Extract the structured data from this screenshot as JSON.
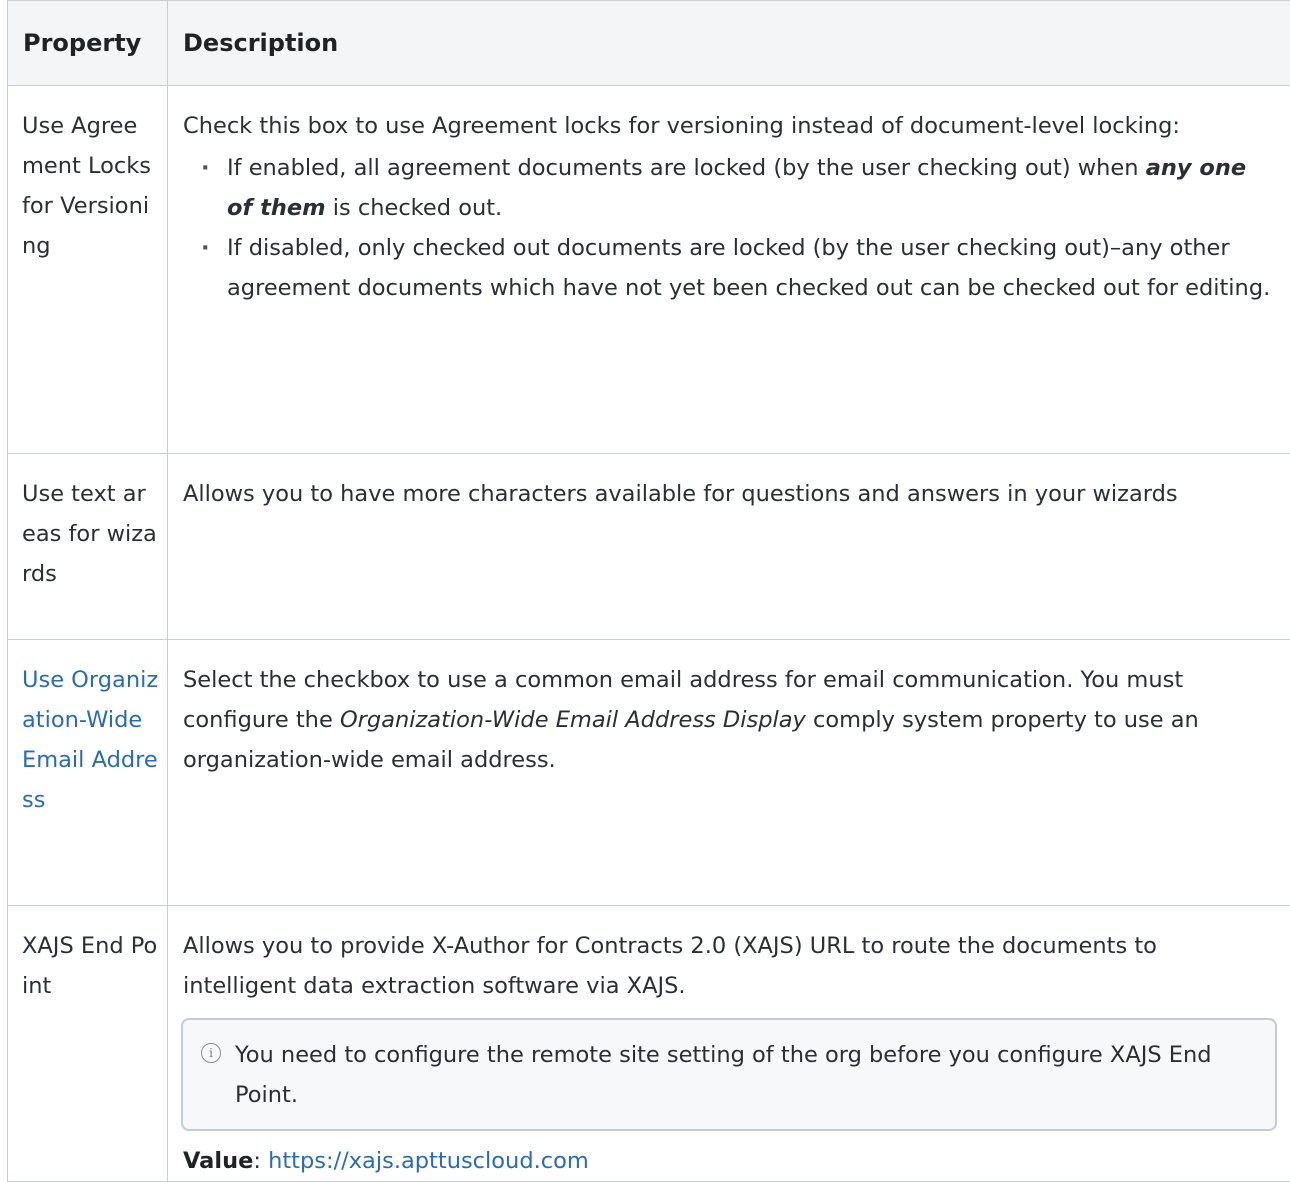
{
  "headers": {
    "property": "Property",
    "description": "Description"
  },
  "rows": [
    {
      "property": "Use Agreement Locks for Versioning",
      "intro": "Check this box to use Agreement locks for versioning instead of document-level locking:",
      "bullet1_a": "If enabled, all agreement documents are locked (by the user checking out) when ",
      "bullet1_em": "any one of them",
      "bullet1_b": " is checked out.",
      "bullet2": "If disabled, only checked out documents are locked (by the user checking out)–any other agreement documents which have not yet been checked out can be checked out for editing."
    },
    {
      "property": "Use text areas for wizards",
      "desc": "Allows you to have more characters available for questions and answers in your wizards"
    },
    {
      "property": "Use Organization-Wide Email Address",
      "desc_a": "Select the checkbox to use a common email address for email communication. You must configure the ",
      "desc_em": "Organization-Wide Email Address Display",
      "desc_b": " comply system property to use an organization-wide email address."
    },
    {
      "property": "XAJS End Point",
      "desc": "Allows you to provide X-Author for Contracts 2.0 (XAJS) URL to route the documents to intelligent data extraction software via XAJS.",
      "note": "You need to configure the remote site setting of the org before you configure XAJS End Point.",
      "value_label": "Value",
      "value_sep": ": ",
      "value_url": "https://xajs.apttuscloud.com"
    }
  ],
  "icons": {
    "note": "info-icon"
  },
  "colors": {
    "link": "#2a6bb5",
    "border": "#c9ced3",
    "header_bg": "#f4f5f6"
  }
}
